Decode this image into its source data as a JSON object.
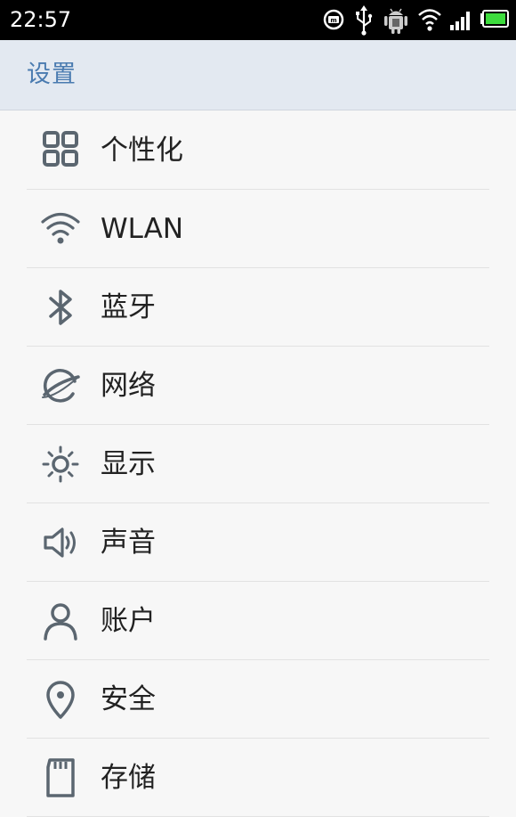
{
  "status_bar": {
    "time": "22:57",
    "icons": [
      "m-notification-icon",
      "usb-icon",
      "android-debug-icon",
      "wifi-icon",
      "signal-icon",
      "battery-icon"
    ]
  },
  "header": {
    "title": "设置"
  },
  "settings": {
    "items": [
      {
        "label": "个性化",
        "icon": "grid-icon"
      },
      {
        "label": "WLAN",
        "icon": "wifi-icon"
      },
      {
        "label": "蓝牙",
        "icon": "bluetooth-icon"
      },
      {
        "label": "网络",
        "icon": "globe-icon"
      },
      {
        "label": "显示",
        "icon": "brightness-icon"
      },
      {
        "label": "声音",
        "icon": "speaker-icon"
      },
      {
        "label": "账户",
        "icon": "person-icon"
      },
      {
        "label": "安全",
        "icon": "location-pin-icon"
      },
      {
        "label": "存储",
        "icon": "sd-card-icon"
      }
    ]
  },
  "colors": {
    "status_bar_bg": "#000000",
    "action_bar_bg": "#e3e9f1",
    "title_color": "#4a7bb0",
    "icon_color": "#5b6670",
    "battery_green": "#3ddc3d"
  }
}
